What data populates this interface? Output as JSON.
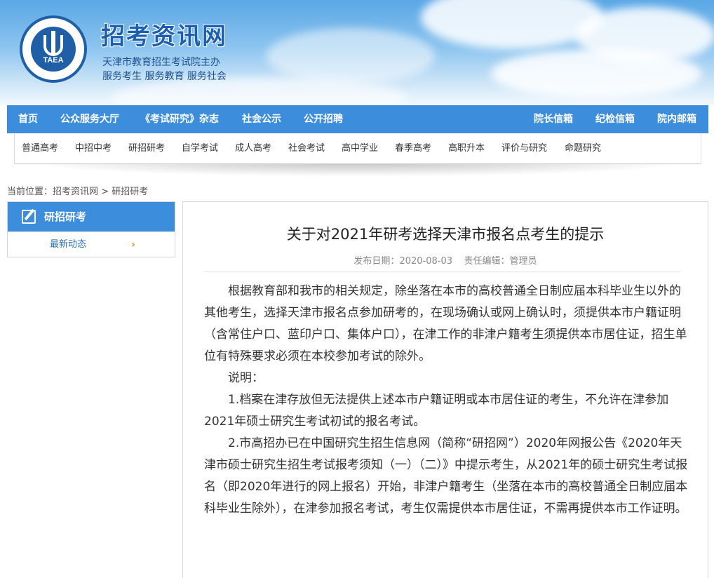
{
  "header": {
    "logo_text": "TAEA",
    "site_title": "招考资讯网",
    "subtitle_1": "天津市教育招生考试院主办",
    "subtitle_2": "服务考生 服务教育 服务社会"
  },
  "main_nav": {
    "items": [
      "首页",
      "公众服务大厅",
      "《考试研究》杂志",
      "社会公示",
      "公开招聘"
    ],
    "right_items": [
      "院长信箱",
      "纪检信箱",
      "院内邮箱"
    ]
  },
  "sub_nav": {
    "items": [
      "普通高考",
      "中招中考",
      "研招研考",
      "自学考试",
      "成人高考",
      "社会考试",
      "高中学业",
      "春季高考",
      "高职升本",
      "评价与研究",
      "命题研究"
    ]
  },
  "breadcrumb": {
    "prefix": "当前位置：",
    "home": "招考资讯网",
    "sep": ">",
    "current": "研招研考"
  },
  "sidebar": {
    "title": "研招研考",
    "items": [
      {
        "label": "最新动态",
        "arrow": "›"
      }
    ]
  },
  "article": {
    "title": "关于对2021年研考选择天津市报名点考生的提示",
    "date_label": "发布日期：",
    "date": "2020-08-03",
    "editor_label": "责任编辑：",
    "editor": "管理员",
    "paragraphs": [
      "根据教育部和我市的相关规定，除坐落在本市的高校普通全日制应届本科毕业生以外的其他考生，选择天津市报名点参加研考的，在现场确认或网上确认时，须提供本市户籍证明（含常住户口、蓝印户口、集体户口），在津工作的非津户籍考生须提供本市居住证，招生单位有特殊要求必须在本校参加考试的除外。",
      "说明：",
      "1.档案在津存放但无法提供上述本市户籍证明或本市居住证的考生，不允许在津参加2021年硕士研究生考试初试的报名考试。",
      "2.市高招办已在中国研究生招生信息网（简称“研招网”）2020年网报公告《2020年天津市硕士研究生招生考试报考须知（一）（二）》中提示考生，从2021年的硕士研究生考试报名（即2020年进行的网上报名）开始，非津户籍考生（坐落在本市的高校普通全日制应届本科毕业生除外），在津参加报名考试，考生仅需提供本市居住证，不需再提供本市工作证明。"
    ]
  },
  "colors": {
    "nav_blue": "#3d8ddd",
    "title_blue": "#1b5fb2",
    "arrow_orange": "#f08a1a"
  }
}
